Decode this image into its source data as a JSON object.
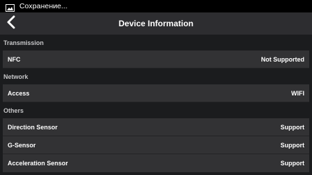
{
  "status_bar": {
    "notification_text": "Сохранение...",
    "icon": "image-icon"
  },
  "app_bar": {
    "title": "Device Information",
    "back_icon": "chevron-left-icon"
  },
  "sections": [
    {
      "title": "Transmission",
      "rows": [
        {
          "label": "NFC",
          "value": "Not Supported"
        }
      ]
    },
    {
      "title": "Network",
      "rows": [
        {
          "label": "Access",
          "value": "WIFI"
        }
      ]
    },
    {
      "title": "Others",
      "rows": [
        {
          "label": "Direction Sensor",
          "value": "Support"
        },
        {
          "label": "G-Sensor",
          "value": "Support"
        },
        {
          "label": "Acceleration Sensor",
          "value": "Support"
        }
      ]
    }
  ],
  "colors": {
    "background": "#1b1c1e",
    "app_bar": "#2d2d30",
    "row": "#323234",
    "status_bar": "#000000"
  }
}
